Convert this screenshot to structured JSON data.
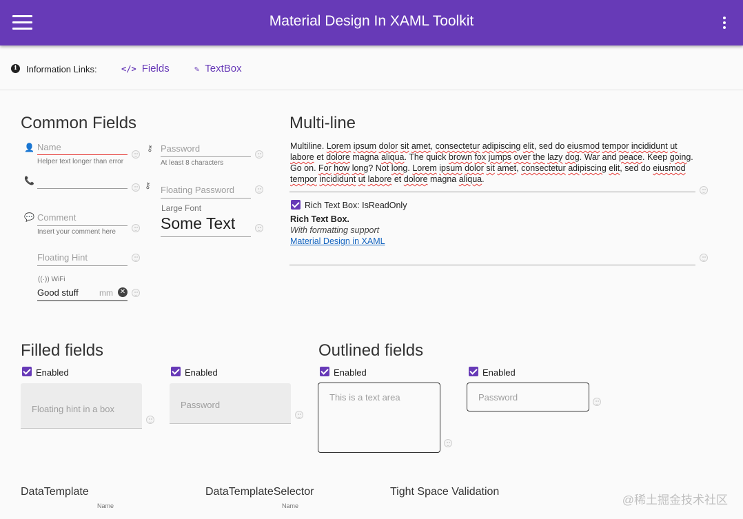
{
  "app": {
    "title": "Material Design In XAML Toolkit",
    "menu_icon": "hamburger-menu-icon",
    "more_icon": "more-vert-icon"
  },
  "info_bar": {
    "label": "Information Links:",
    "links": [
      {
        "label": "Fields",
        "icon": "code-icon"
      },
      {
        "label": "TextBox",
        "icon": "brush-icon"
      }
    ]
  },
  "common_fields": {
    "title": "Common Fields",
    "name": {
      "hint": "Name",
      "helper": "Helper text longer than error"
    },
    "phone": {
      "hint": ""
    },
    "comment": {
      "hint": "Comment",
      "helper": "Insert your comment here"
    },
    "floating_hint": {
      "hint": "Floating Hint"
    },
    "wifi": {
      "label": "WiFi",
      "value": "Good stuff",
      "suffix": "mm"
    },
    "password": {
      "hint": "Password",
      "helper": "At least 8 characters"
    },
    "floating_password": {
      "hint": "Floating Password"
    },
    "large_font": {
      "label": "Large Font",
      "value": "Some Text"
    }
  },
  "multi_line": {
    "title": "Multi-line",
    "text": "Multiline. Lorem ipsum dolor sit amet, consectetur adipiscing elit, sed do eiusmod tempor incididunt ut labore et dolore magna aliqua. The quick brown fox jumps over the lazy dog. War and peace. Keep going. Go on. For how long? Not long. Lorem ipsum dolor sit amet, consectetur adipiscing elit, sed do eiusmod tempor incididunt ut labore et dolore magna aliqua.",
    "rich_checkbox_label": "Rich Text Box: IsReadOnly",
    "rich_bold": "Rich Text Box.",
    "rich_italic": "With formatting support",
    "rich_link": "Material Design in XAML"
  },
  "filled_fields": {
    "title": "Filled fields",
    "items": [
      {
        "checkbox": "Enabled",
        "hint": "Floating hint in a box"
      },
      {
        "checkbox": "Enabled",
        "hint": "Password"
      }
    ]
  },
  "outlined_fields": {
    "title": "Outlined fields",
    "items": [
      {
        "checkbox": "Enabled",
        "hint": "This is a text area"
      },
      {
        "checkbox": "Enabled",
        "hint": "Password"
      }
    ]
  },
  "bottom": {
    "data_template": {
      "title": "DataTemplate",
      "label": "Name"
    },
    "data_template_selector": {
      "title": "DataTemplateSelector",
      "label": "Name"
    },
    "tight_space": {
      "title": "Tight Space Validation"
    }
  },
  "watermark": "@稀土掘金技术社区",
  "colors": {
    "primary": "#673ab7",
    "error": "#e53935",
    "link": "#1565c0"
  }
}
